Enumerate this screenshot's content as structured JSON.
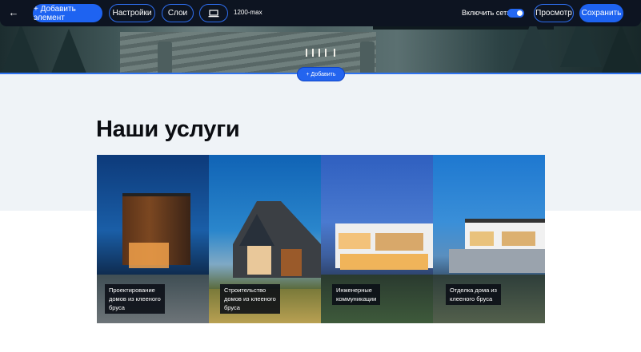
{
  "toolbar": {
    "back_icon": "arrow-left-icon",
    "add_element_label": "+ Добавить элемент",
    "settings_label": "Настройки",
    "layers_label": "Слои",
    "device_icon": "laptop-icon",
    "resolution": "1200-max",
    "grid_label": "Включить сетку",
    "grid_enabled": true,
    "preview_label": "Просмотр",
    "save_label": "Сохранить"
  },
  "add_block_label": "+ Добавить",
  "section": {
    "title": "Наши услуги",
    "cards": [
      {
        "caption": "Проектирование\nдомов из клееного\nбруса"
      },
      {
        "caption": "Строительство\nдомов из клееного\nбруса"
      },
      {
        "caption": "Инженерные\nкоммуникации"
      },
      {
        "caption": "Отделка дома из\nклееного бруса"
      }
    ]
  },
  "colors": {
    "accent": "#1e63f1",
    "toolbar_bg": "#0d1421",
    "section_bg": "#eff3f7"
  }
}
